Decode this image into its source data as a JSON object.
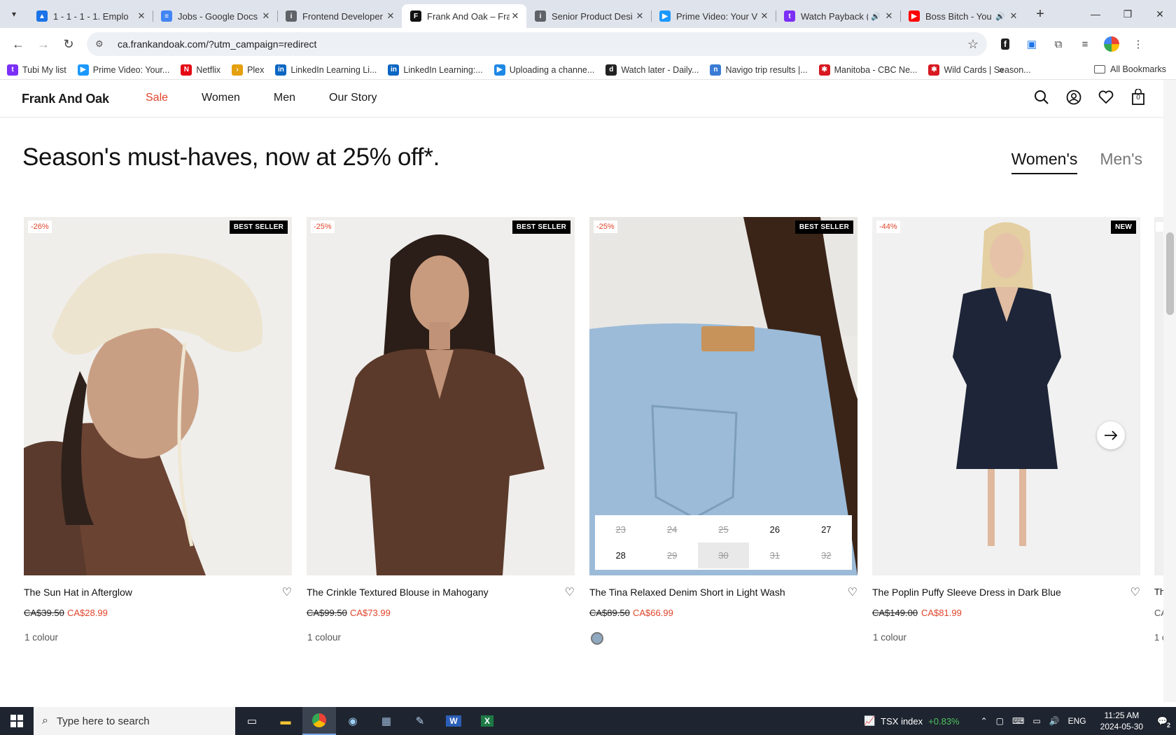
{
  "browser": {
    "tabs": [
      {
        "title": "1 - 1 - 1 - 1. Emplo",
        "icon": "google-drive-icon",
        "color": "#1a73e8",
        "glyph": "▲"
      },
      {
        "title": "Jobs - Google Docs",
        "icon": "google-docs-icon",
        "color": "#4285f4",
        "glyph": "≡"
      },
      {
        "title": "Frontend Developer",
        "icon": "info-icon",
        "color": "#5f6368",
        "glyph": "i"
      },
      {
        "title": "Frank And Oak – Fra",
        "icon": "frank-and-oak-icon",
        "color": "#111111",
        "glyph": "F",
        "active": true
      },
      {
        "title": "Senior Product Desi",
        "icon": "info-icon",
        "color": "#5f6368",
        "glyph": "i"
      },
      {
        "title": "Prime Video: Your V",
        "icon": "prime-video-icon",
        "color": "#1a98ff",
        "glyph": "▶"
      },
      {
        "title": "Watch Payback (",
        "icon": "tubi-icon",
        "color": "#7b2ff7",
        "glyph": "t",
        "audio": "🔊"
      },
      {
        "title": "Boss Bitch - You",
        "icon": "youtube-icon",
        "color": "#ff0000",
        "glyph": "▶",
        "audio": "🔊"
      }
    ],
    "url": "ca.frankandoak.com/?utm_campaign=redirect",
    "bookmarks": [
      {
        "label": "Tubi My list",
        "icon": "tubi-icon",
        "color": "#7b2ff7",
        "glyph": "t"
      },
      {
        "label": "Prime Video: Your...",
        "icon": "prime-video-icon",
        "color": "#1a98ff",
        "glyph": "▶"
      },
      {
        "label": "Netflix",
        "icon": "netflix-icon",
        "color": "#e50914",
        "glyph": "N"
      },
      {
        "label": "Plex",
        "icon": "plex-icon",
        "color": "#e5a00d",
        "glyph": "›"
      },
      {
        "label": "LinkedIn Learning Li...",
        "icon": "linkedin-icon",
        "color": "#0a66c2",
        "glyph": "in"
      },
      {
        "label": "LinkedIn Learning:...",
        "icon": "linkedin-icon",
        "color": "#0a66c2",
        "glyph": "in"
      },
      {
        "label": "Uploading a channe...",
        "icon": "video-icon",
        "color": "#1e88e5",
        "glyph": "▶"
      },
      {
        "label": "Watch later - Daily...",
        "icon": "dailymotion-icon",
        "color": "#222222",
        "glyph": "d"
      },
      {
        "label": "Navigo trip results |...",
        "icon": "navigo-icon",
        "color": "#3a7bd5",
        "glyph": "n"
      },
      {
        "label": "Manitoba - CBC Ne...",
        "icon": "cbc-icon",
        "color": "#d71920",
        "glyph": "✱"
      },
      {
        "label": "Wild Cards | Season...",
        "icon": "cbc-icon",
        "color": "#d71920",
        "glyph": "✱"
      }
    ],
    "all_bookmarks": "All Bookmarks"
  },
  "site": {
    "logo": "Frank And Oak",
    "nav": {
      "sale": "Sale",
      "women": "Women",
      "men": "Men",
      "story": "Our Story"
    },
    "cart_count": "0"
  },
  "page": {
    "headline": "Season's must-haves, now at 25% off*.",
    "tab_women": "Women's",
    "tab_men": "Men's"
  },
  "products": [
    {
      "name": "The Sun Hat in Afterglow",
      "discount": "-26%",
      "tag": "BEST SELLER",
      "old_price": "CA$39.50",
      "new_price": "CA$28.99",
      "colours": "1 colour"
    },
    {
      "name": "The Crinkle Textured Blouse in Mahogany",
      "discount": "-25%",
      "tag": "BEST SELLER",
      "old_price": "CA$99.50",
      "new_price": "CA$73.99",
      "colours": "1 colour"
    },
    {
      "name": "The Tina Relaxed Denim Short in Light Wash",
      "discount": "-25%",
      "tag": "BEST SELLER",
      "old_price": "CA$89.50",
      "new_price": "CA$66.99",
      "sizes": [
        {
          "label": "23",
          "available": false
        },
        {
          "label": "24",
          "available": false
        },
        {
          "label": "25",
          "available": false
        },
        {
          "label": "26",
          "available": true
        },
        {
          "label": "27",
          "available": true
        },
        {
          "label": "28",
          "available": true
        },
        {
          "label": "29",
          "available": false
        },
        {
          "label": "30",
          "available": false,
          "hovered": true
        },
        {
          "label": "31",
          "available": false
        },
        {
          "label": "32",
          "available": false
        }
      ]
    },
    {
      "name": "The Poplin Puffy Sleeve Dress in Dark Blue",
      "discount": "-44%",
      "tag": "NEW",
      "old_price": "CA$149.00",
      "new_price": "CA$81.99",
      "colours": "1 colour"
    }
  ],
  "peek": {
    "name": "Th",
    "price": "CA",
    "colours": "1 c"
  },
  "taskbar": {
    "search_placeholder": "Type here to search",
    "tsx_label": "TSX index",
    "tsx_change": "+0.83%",
    "lang": "ENG",
    "time": "11:25 AM",
    "date": "2024-05-30",
    "notifications": "2"
  },
  "colors": {
    "sale": "#e0442b",
    "text": "#111111"
  }
}
